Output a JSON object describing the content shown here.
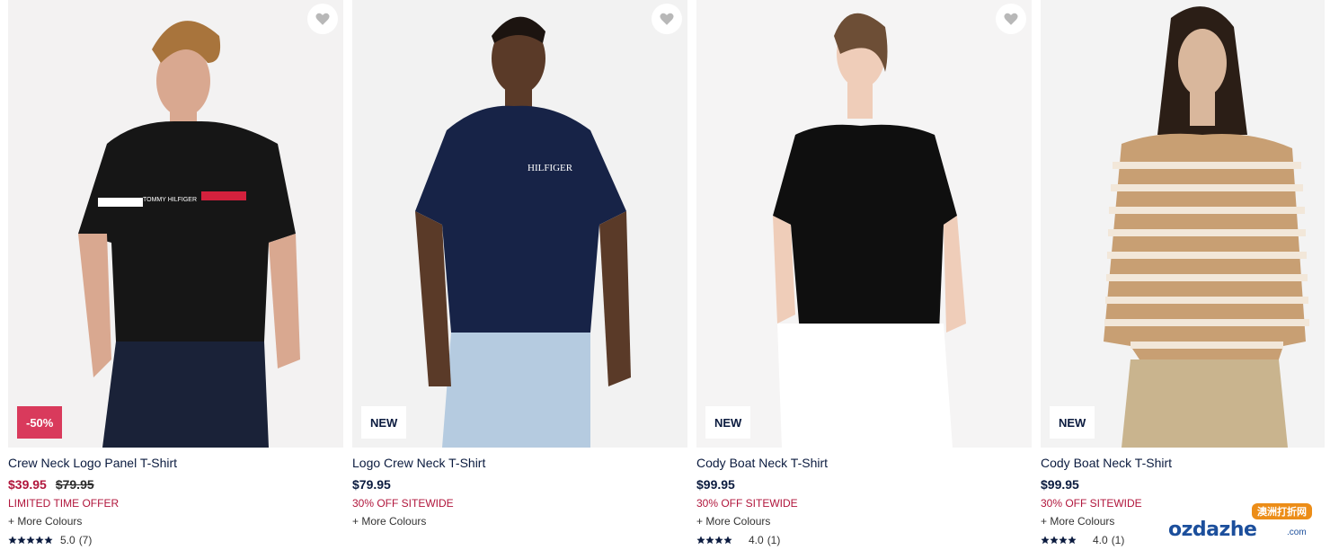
{
  "products": [
    {
      "title": "Crew Neck Logo Panel T-Shirt",
      "badge": "-50%",
      "price_sale": "$39.95",
      "price_old": "$79.95",
      "promo": "LIMITED TIME OFFER",
      "colours": "+ More Colours",
      "rating_value": "5.0",
      "rating_count": "(7)",
      "stars": 5
    },
    {
      "title": "Logo Crew Neck T-Shirt",
      "badge": "NEW",
      "price": "$79.95",
      "promo": "30% OFF SITEWIDE",
      "colours": "+ More Colours"
    },
    {
      "title": "Cody Boat Neck T-Shirt",
      "badge": "NEW",
      "price": "$99.95",
      "promo": "30% OFF SITEWIDE",
      "colours": "+ More Colours",
      "rating_value": "4.0",
      "rating_count": "(1)",
      "stars": 4
    },
    {
      "title": "Cody Boat Neck T-Shirt",
      "badge": "NEW",
      "price": "$99.95",
      "promo": "30% OFF SITEWIDE",
      "colours": "+ More Colours",
      "rating_value": "4.0",
      "rating_count": "(1)",
      "stars": 4
    }
  ],
  "shirt_print": {
    "product1_chest": "TOMMY HILFIGER",
    "product2_chest": "HILFIGER"
  },
  "watermark": {
    "logo": "ozdazhe",
    "domain": ".com",
    "tag": "澳洲打折网"
  },
  "icons": {
    "wishlist": "heart-icon",
    "rating": "star-icon"
  },
  "colors": {
    "navy": "#0b1b3f",
    "sale_red": "#b1163c",
    "sale_badge": "#d93a5c"
  }
}
